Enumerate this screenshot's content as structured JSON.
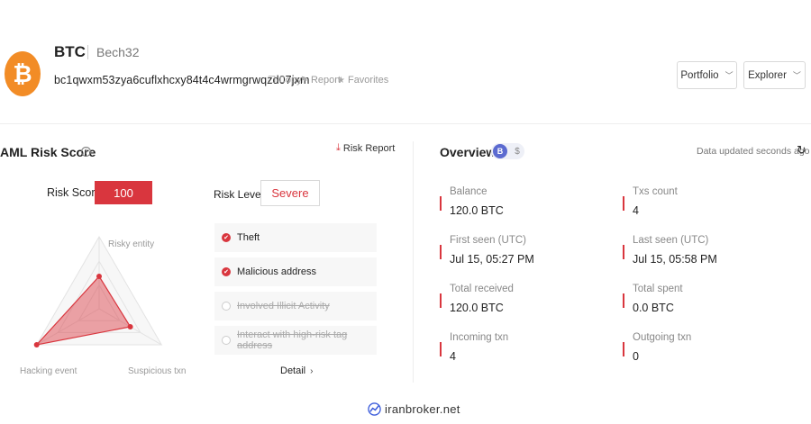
{
  "coin": {
    "logo_glyph": "₿",
    "logo_color": "#f28c26",
    "symbol": "BTC",
    "format": "Bech32",
    "address": "bc1qwxm53zya6cuflxhcxy84t4c4wrmgrwqzd07jxm"
  },
  "address_actions": {
    "copy": "Copy",
    "report": "Report",
    "favorites": "Favorites"
  },
  "header_buttons": {
    "portfolio": "Portfolio",
    "explorer": "Explorer"
  },
  "aml": {
    "title": "AML Risk Score",
    "risk_report": "Risk Report",
    "score_label": "Risk Score:",
    "score": "100",
    "level_label": "Risk Level:",
    "level": "Severe",
    "accent_color": "#d9363e",
    "radar": {
      "axes": [
        "Risky entity",
        "Suspicious txn",
        "Hacking event"
      ],
      "values": [
        0.45,
        0.5,
        1.0
      ]
    },
    "risk_items": [
      {
        "label": "Theft",
        "active": true
      },
      {
        "label": "Malicious address",
        "active": true
      },
      {
        "label": "Involved Illicit Activity",
        "active": false
      },
      {
        "label": "Interact with high-risk tag address",
        "active": false
      }
    ],
    "detail": "Detail"
  },
  "overview": {
    "title": "Overview",
    "toggle_active": "B",
    "toggle_inactive": "$",
    "updated": "Data updated seconds ago",
    "stats": [
      {
        "label": "Balance",
        "value": "120.0 BTC"
      },
      {
        "label": "Txs count",
        "value": "4"
      },
      {
        "label": "First seen (UTC)",
        "value": "Jul 15, 05:27 PM"
      },
      {
        "label": "Last seen (UTC)",
        "value": "Jul 15, 05:58 PM"
      },
      {
        "label": "Total received",
        "value": "120.0 BTC"
      },
      {
        "label": "Total spent",
        "value": "0.0 BTC"
      },
      {
        "label": "Incoming txn",
        "value": "4"
      },
      {
        "label": "Outgoing txn",
        "value": "0"
      }
    ]
  },
  "watermark": "iranbroker.net"
}
